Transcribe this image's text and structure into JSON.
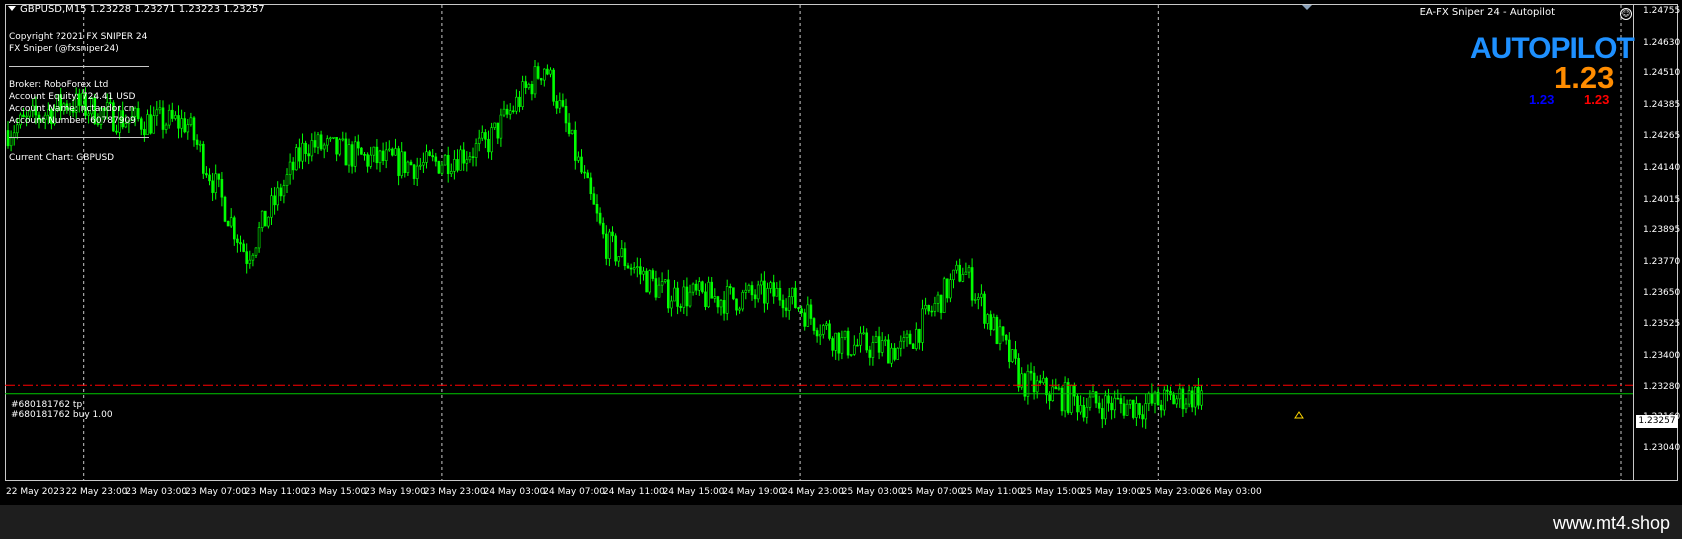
{
  "header": {
    "symbol_line": "GBPUSD,M15  1.23228 1.23271 1.23223 1.23257",
    "ea_title": "EA-FX Sniper 24 - Autopilot"
  },
  "info_panel": {
    "copyright": "Copyright ?2021 FX SNIPER 24",
    "author": "FX Sniper (@fxsniper24)",
    "broker": "Broker: RoboForex Ltd",
    "equity": "Account Equity: 724.41 USD",
    "account_name": "Account Name: nctandor cn",
    "account_number": "Account Number: 60787909",
    "current_chart": "Current Chart: GBPUSD"
  },
  "badge": {
    "title": "AUTOPILOT",
    "price_big": "1.23",
    "price_blue": "1.23",
    "price_red": "1.23"
  },
  "orders": {
    "tp_label": "#680181762 tp",
    "buy_label": "#680181762 buy 1.00"
  },
  "colors": {
    "candle": "#00ff00",
    "tp_line": "#ff0000",
    "buy_line": "#00c800",
    "grid": "#c8c8c8"
  },
  "price_axis": {
    "labels": [
      "1.24755",
      "1.24630",
      "1.24510",
      "1.24385",
      "1.24265",
      "1.24140",
      "1.24015",
      "1.23895",
      "1.23770",
      "1.23650",
      "1.23525",
      "1.23400",
      "1.23280",
      "1.23160",
      "1.23040"
    ],
    "current_price": "1.23257",
    "min": 1.2304,
    "max": 1.24755
  },
  "time_axis": {
    "labels": [
      "22 May 2023",
      "22 May 23:00",
      "23 May 03:00",
      "23 May 07:00",
      "23 May 11:00",
      "23 May 15:00",
      "23 May 19:00",
      "23 May 23:00",
      "24 May 03:00",
      "24 May 07:00",
      "24 May 11:00",
      "24 May 15:00",
      "24 May 19:00",
      "24 May 23:00",
      "25 May 03:00",
      "25 May 07:00",
      "25 May 11:00",
      "25 May 15:00",
      "25 May 19:00",
      "25 May 23:00",
      "26 May 03:00"
    ]
  },
  "chart_data": {
    "type": "candlestick",
    "symbol": "GBPUSD",
    "timeframe": "M15",
    "last_bar": {
      "open": 1.23228,
      "high": 1.23271,
      "low": 1.23223,
      "close": 1.23257
    },
    "tp_level": 1.2329,
    "buy_level": 1.23257,
    "ylim": [
      1.2304,
      1.24755
    ],
    "price_path": [
      [
        "22 May 2023",
        1.2429
      ],
      [
        "22 May 23:00",
        1.244
      ],
      [
        "23 May 03:00",
        1.2433
      ],
      [
        "23 May 07:00",
        1.2432
      ],
      [
        "23 May 11:00",
        1.238
      ],
      [
        "23 May 15:00",
        1.2424
      ],
      [
        "23 May 19:00",
        1.2418
      ],
      [
        "23 May 23:00",
        1.2415
      ],
      [
        "24 May 03:00",
        1.2423
      ],
      [
        "24 May 07:00",
        1.2455
      ],
      [
        "24 May 11:00",
        1.2385
      ],
      [
        "24 May 15:00",
        1.2365
      ],
      [
        "24 May 19:00",
        1.2363
      ],
      [
        "24 May 23:00",
        1.2365
      ],
      [
        "25 May 03:00",
        1.2345
      ],
      [
        "25 May 07:00",
        1.2343
      ],
      [
        "25 May 11:00",
        1.2375
      ],
      [
        "25 May 15:00",
        1.233
      ],
      [
        "25 May 19:00",
        1.2322
      ],
      [
        "25 May 23:00",
        1.2321
      ],
      [
        "26 May 03:00",
        1.23257
      ]
    ]
  },
  "footer": {
    "watermark": "www.mt4.shop"
  }
}
